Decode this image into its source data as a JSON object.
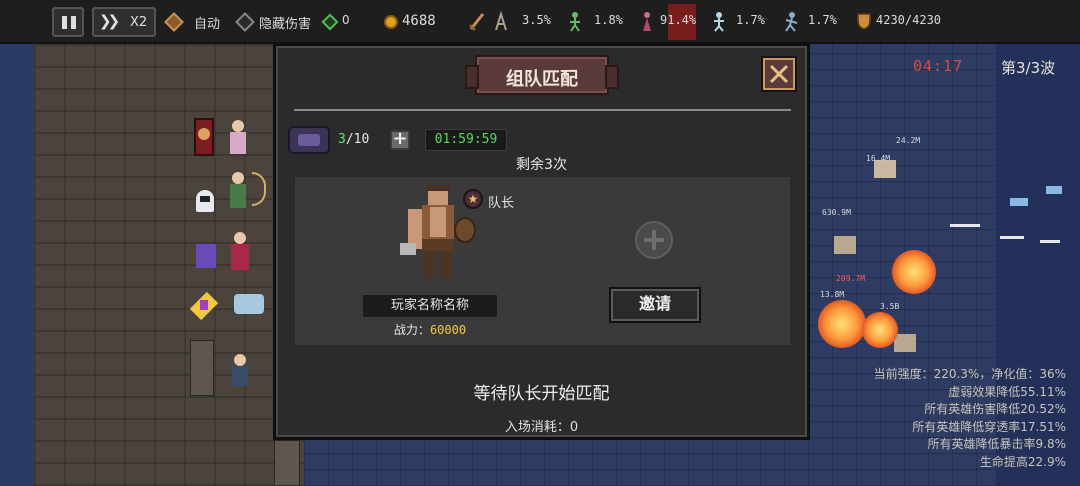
{
  "topbar": {
    "speed_label": "X2",
    "auto_label": "自动",
    "hide_damage_label": "隐藏伤害",
    "gem_count": "0",
    "gold": "4688",
    "stats": [
      {
        "icon": "sword-icon",
        "value": "3.5%"
      },
      {
        "icon": "archer-icon",
        "value": "1.8%"
      },
      {
        "icon": "mage-icon",
        "value": "91.4%"
      },
      {
        "icon": "spirit-icon",
        "value": "1.7%"
      },
      {
        "icon": "assassin-icon",
        "value": "1.7%"
      }
    ],
    "hp": "4230/4230",
    "colors": {
      "bar_bg": "#1e1e1e",
      "gold": "#e0a020",
      "highlight": "#7a1d1d",
      "gem": "#4ec04e"
    }
  },
  "battle": {
    "timer": "04:17",
    "wave": "第3/3波",
    "damage_numbers": [
      "24.2M",
      "16.4M",
      "630.9M",
      "13.8M",
      "3.5B",
      "209.7M"
    ],
    "buffs": [
      "当前强度：220.3%，净化值：36%",
      "虚弱效果降低55.11%",
      "所有英雄伤害降低20.52%",
      "所有英雄降低穿透率17.51%",
      "所有英雄降低暴击率9.8%",
      "生命提高22.9%"
    ]
  },
  "modal": {
    "title": "组队匹配",
    "tickets_current": "3",
    "tickets_max": "/10",
    "countdown": "01:59:59",
    "remaining": "剩余3次",
    "captain_label": "队长",
    "player_name": "玩家名称名称",
    "power_label": "战力：",
    "power_value": "60000",
    "invite_label": "邀请",
    "waiting_text": "等待队长开始匹配",
    "entry_cost": "入场消耗：0"
  }
}
